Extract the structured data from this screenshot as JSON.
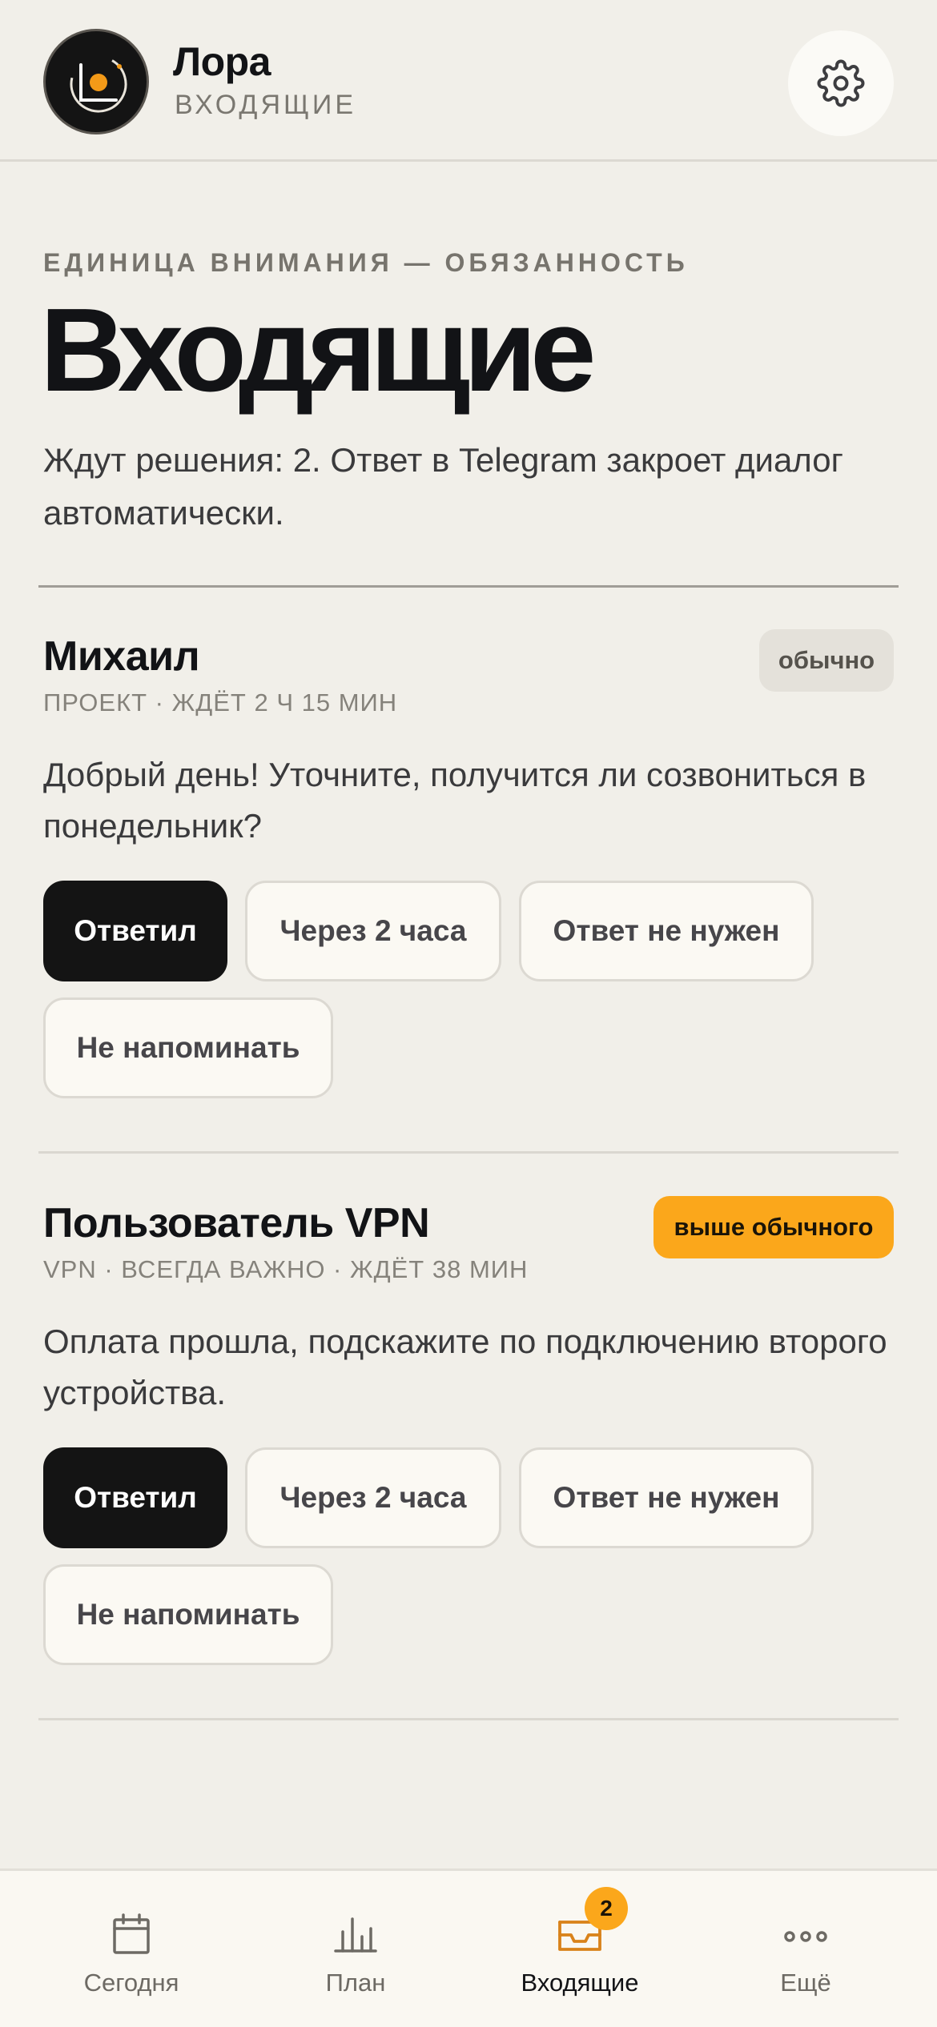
{
  "header": {
    "app_name": "Лора",
    "section": "ВХОДЯЩИЕ",
    "avatar_icon": "lora-logo-icon",
    "settings_icon": "gear-icon"
  },
  "intro": {
    "eyebrow": "ЕДИНИЦА ВНИМАНИЯ — ОБЯЗАННОСТЬ",
    "title": "Входящие",
    "description": "Ждут решения: 2. Ответ в Telegram закроет диалог автоматически."
  },
  "cards": [
    {
      "name": "Михаил",
      "meta": "ПРОЕКТ · ЖДЁТ 2 Ч 15 МИН",
      "priority": "обычно",
      "message": "Добрый день! Уточните, получится ли созвониться в понедельник?",
      "actions": [
        "Ответил",
        "Через 2 часа",
        "Ответ не нужен",
        "Не напоминать"
      ]
    },
    {
      "name": "Пользователь VPN",
      "meta": "VPN · ВСЕГДА ВАЖНО · ЖДЁТ 38 МИН",
      "priority": "выше обычного",
      "message": "Оплата прошла, подскажите по подключению второго устройства.",
      "actions": [
        "Ответил",
        "Через 2 часа",
        "Ответ не нужен",
        "Не напоминать"
      ]
    }
  ],
  "nav": {
    "items": [
      {
        "label": "Сегодня",
        "icon": "calendar-icon"
      },
      {
        "label": "План",
        "icon": "bar-chart-icon"
      },
      {
        "label": "Входящие",
        "icon": "inbox-icon"
      },
      {
        "label": "Ещё",
        "icon": "more-icon"
      }
    ],
    "inbox_badge": "2"
  },
  "colors": {
    "background": "#f1efe9",
    "accent": "#fba71b",
    "primary_button": "#141414",
    "active_nav": "#d9821a"
  }
}
